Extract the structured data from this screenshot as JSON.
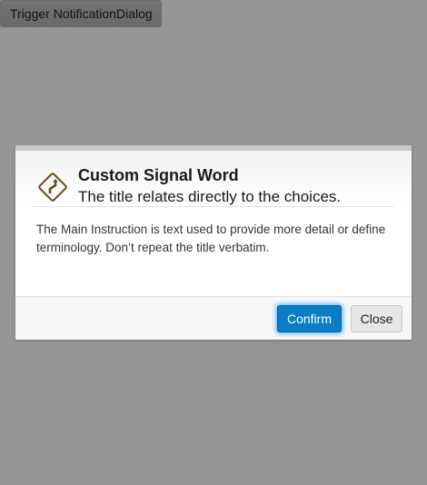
{
  "trigger": {
    "label": "Trigger NotificationDialog"
  },
  "dialog": {
    "icon": "road-curve-warning-sign-icon",
    "title": "Custom Signal Word",
    "subtitle": "The title relates directly to the choices.",
    "body": "The Main Instruction is text used to provide more detail or define terminology. Don’t repeat the title verbatim.",
    "buttons": {
      "confirm_label": "Confirm",
      "close_label": "Close"
    }
  },
  "colors": {
    "overlay": "#969696",
    "primary_button": "#0a7dc6",
    "icon_brown": "#6b4a1c"
  }
}
